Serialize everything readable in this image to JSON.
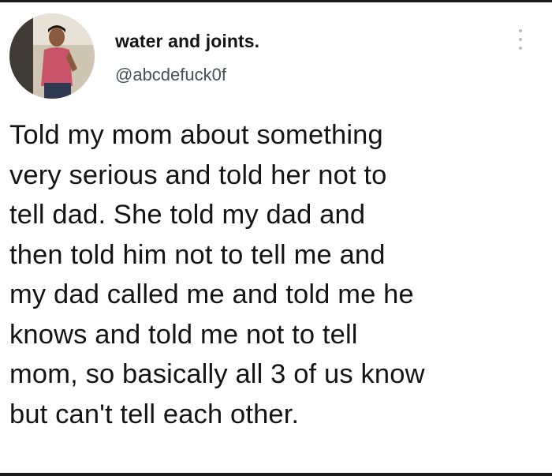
{
  "tweet": {
    "author": {
      "display_name": "water and joints.",
      "handle": "@abcdefuck0f",
      "avatar_icon": "profile-photo"
    },
    "more_icon": "vertical-ellipsis-icon",
    "text_lines": [
      "Told my mom about something",
      "very serious and told her not to",
      "tell dad. She told my dad and",
      "then told him not to tell me and",
      "my dad called me and told me he",
      "knows and told me not to tell",
      "mom, so basically all 3 of us know",
      "but can't tell each other."
    ]
  },
  "colors": {
    "text": "#141414",
    "handle": "#4a4f55",
    "border": "#1a1a1a",
    "background": "#ffffff"
  }
}
